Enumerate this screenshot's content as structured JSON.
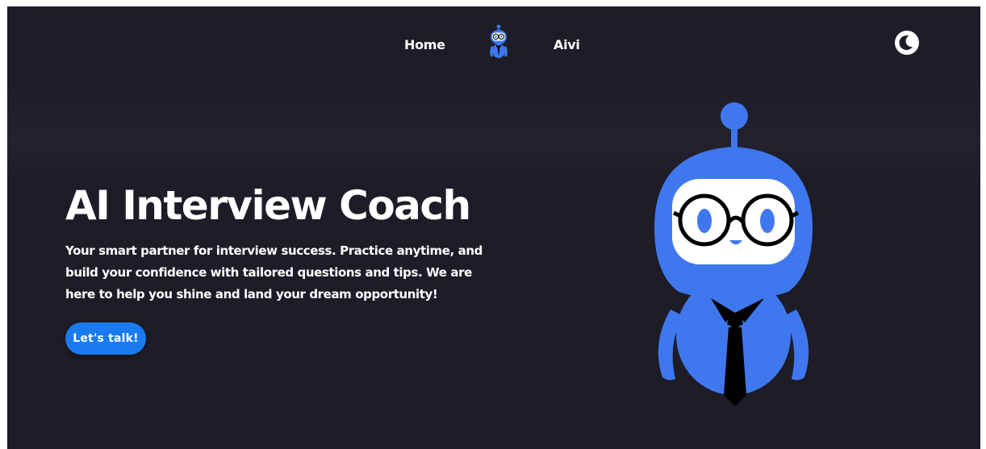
{
  "nav": {
    "home_label": "Home",
    "brand_label": "Aivi",
    "logo_icon": "robot-logo-icon",
    "theme_icon": "moon-icon"
  },
  "hero": {
    "title": "AI Interview Coach",
    "subtitle": "Your smart partner for interview success. Practice anytime, and build your confidence with tailored questions and tips. We are here to help you shine and land your dream opportunity!",
    "cta_label": "Let's talk!",
    "illustration_icon": "robot-mascot-icon"
  },
  "colors": {
    "background": "#1e1c27",
    "accent": "#1a7bf0",
    "robot_blue": "#3f78ee",
    "text": "#ffffff"
  }
}
